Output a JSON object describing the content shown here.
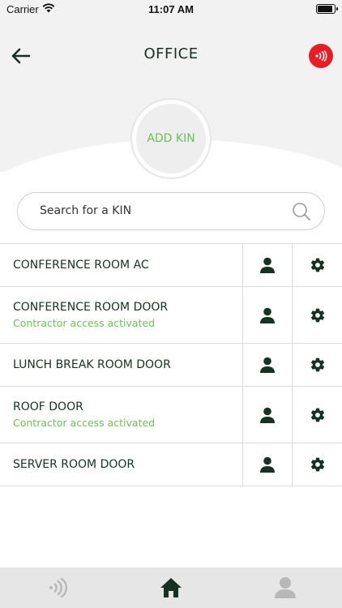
{
  "status_bar": {
    "carrier": "Carrier",
    "time": "11:07 AM"
  },
  "header": {
    "title": "OFFICE"
  },
  "add_kin": {
    "label": "ADD KIN"
  },
  "search": {
    "placeholder": "Search for a KIN"
  },
  "rooms": [
    {
      "name": "CONFERENCE ROOM AC",
      "status": ""
    },
    {
      "name": "CONFERENCE ROOM DOOR",
      "status": "Contractor access activated"
    },
    {
      "name": "LUNCH BREAK ROOM DOOR",
      "status": ""
    },
    {
      "name": "ROOF DOOR",
      "status": "Contractor access activated"
    },
    {
      "name": "SERVER ROOM DOOR",
      "status": ""
    }
  ],
  "tab_bar": {
    "items": [
      "nfc-icon",
      "home-icon",
      "profile-icon"
    ],
    "active": "home-icon"
  },
  "colors": {
    "primary": "#173222",
    "accent_green": "#6bbf59",
    "nfc_red": "#e61e25",
    "tab_inactive": "#b8b8b8"
  }
}
